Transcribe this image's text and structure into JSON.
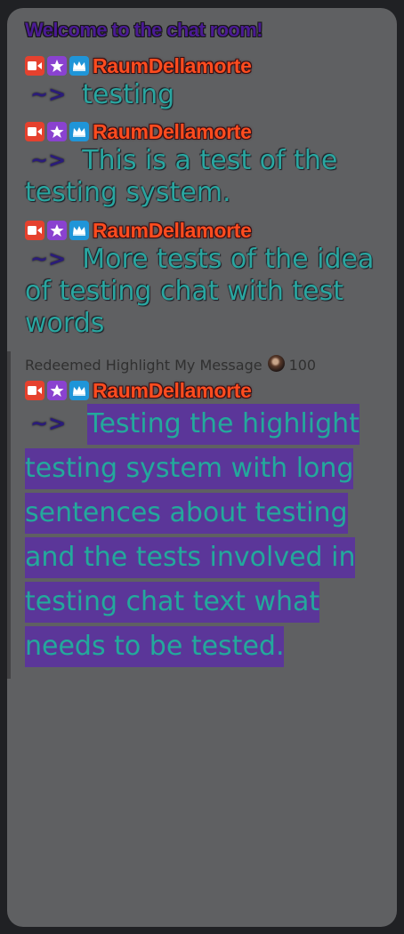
{
  "chat": {
    "welcome": "Welcome to the chat room!",
    "separator": "~>",
    "badges": [
      "broadcaster-icon",
      "vip-star-icon",
      "prime-crown-icon"
    ],
    "messages": [
      {
        "username": "RaumDellamorte",
        "text": "testing"
      },
      {
        "username": "RaumDellamorte",
        "text": "This is a test of the testing system."
      },
      {
        "username": "RaumDellamorte",
        "text": "More tests of the idea of testing chat with test words"
      }
    ],
    "redemption": {
      "label": "Redeemed Highlight My Message",
      "cost": "100",
      "username": "RaumDellamorte",
      "text": "Testing the highlight testing system with long sentences about testing and the tests involved in testing chat text what needs to be tested."
    }
  },
  "colors": {
    "panel_bg": "#5f6062",
    "username": "#ff4c1f",
    "message_text": "#2aa6a0",
    "highlight_bg": "#5b3699",
    "welcome_text": "#4b1b94"
  }
}
